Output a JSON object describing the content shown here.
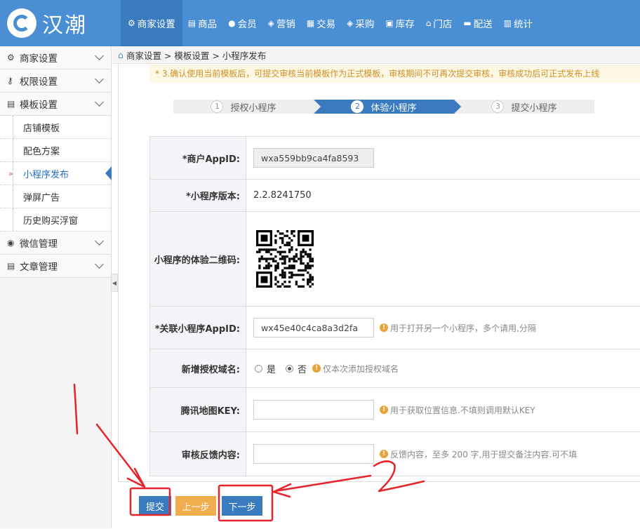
{
  "brand": {
    "name": "汉潮"
  },
  "nav": [
    {
      "icon": "gear-icon",
      "glyph": "⚙",
      "label": "商家设置",
      "active": true
    },
    {
      "icon": "goods-icon",
      "glyph": "▤",
      "label": "商品"
    },
    {
      "icon": "member-icon",
      "glyph": "●",
      "label": "会员"
    },
    {
      "icon": "marketing-icon",
      "glyph": "◈",
      "label": "营销"
    },
    {
      "icon": "trade-icon",
      "glyph": "▦",
      "label": "交易"
    },
    {
      "icon": "purchase-icon",
      "glyph": "◈",
      "label": "采购"
    },
    {
      "icon": "stock-icon",
      "glyph": "▣",
      "label": "库存"
    },
    {
      "icon": "store-icon",
      "glyph": "⌂",
      "label": "门店"
    },
    {
      "icon": "delivery-icon",
      "glyph": "▬",
      "label": "配送"
    },
    {
      "icon": "stats-icon",
      "glyph": "▥",
      "label": "统计"
    }
  ],
  "sidebar": {
    "groups": [
      {
        "label": "商家设置",
        "glyph": "⚙"
      },
      {
        "label": "权限设置",
        "glyph": "⚷"
      },
      {
        "label": "模板设置",
        "glyph": "▤"
      }
    ],
    "subs": [
      {
        "label": "店铺模板"
      },
      {
        "label": "配色方案"
      },
      {
        "label": "小程序发布",
        "active": true
      },
      {
        "label": "弹屏广告"
      },
      {
        "label": "历史购买浮窗"
      }
    ],
    "groups2": [
      {
        "label": "微信管理",
        "glyph": "◉"
      },
      {
        "label": "文章管理",
        "glyph": "▤"
      }
    ]
  },
  "breadcrumb": "商家设置 > 模板设置 > 小程序发布",
  "notice": "* 3.确认使用当前模板后，可提交审核当前模板作为正式模板，审核期间不可再次提交审核，审核成功后可正式发布上线",
  "steps": [
    {
      "num": "1",
      "label": "授权小程序"
    },
    {
      "num": "2",
      "label": "体验小程序",
      "active": true
    },
    {
      "num": "3",
      "label": "提交小程序"
    }
  ],
  "form": {
    "appid_label": "*商户AppID:",
    "appid_value": "wxa559bb9ca4fa8593",
    "version_label": "*小程序版本:",
    "version_value": "2.2.8241750",
    "qrcode_label": "小程序的体验二维码:",
    "linked_label": "*关联小程序AppID:",
    "linked_value": "wx45e40c4ca8a3d2fa",
    "linked_hint": "用于打开另一个小程序，多个请用,分隔",
    "domain_label": "新增授权域名:",
    "domain_yes": "是",
    "domain_no": "否",
    "domain_hint": "仅本次添加授权域名",
    "map_label": "腾讯地图KEY:",
    "map_value": "",
    "map_hint": "用于获取位置信息.不填则调用默认KEY",
    "feedback_label": "审核反馈内容:",
    "feedback_value": "",
    "feedback_hint": "反馈内容，至多 200 字,用于提交备注内容.可不填"
  },
  "buttons": {
    "submit": "提交",
    "prev": "上一步",
    "next": "下一步"
  },
  "colors": {
    "primary": "#3a7bbf",
    "warning": "#f0ad4e",
    "annotation": "#e5242b"
  }
}
